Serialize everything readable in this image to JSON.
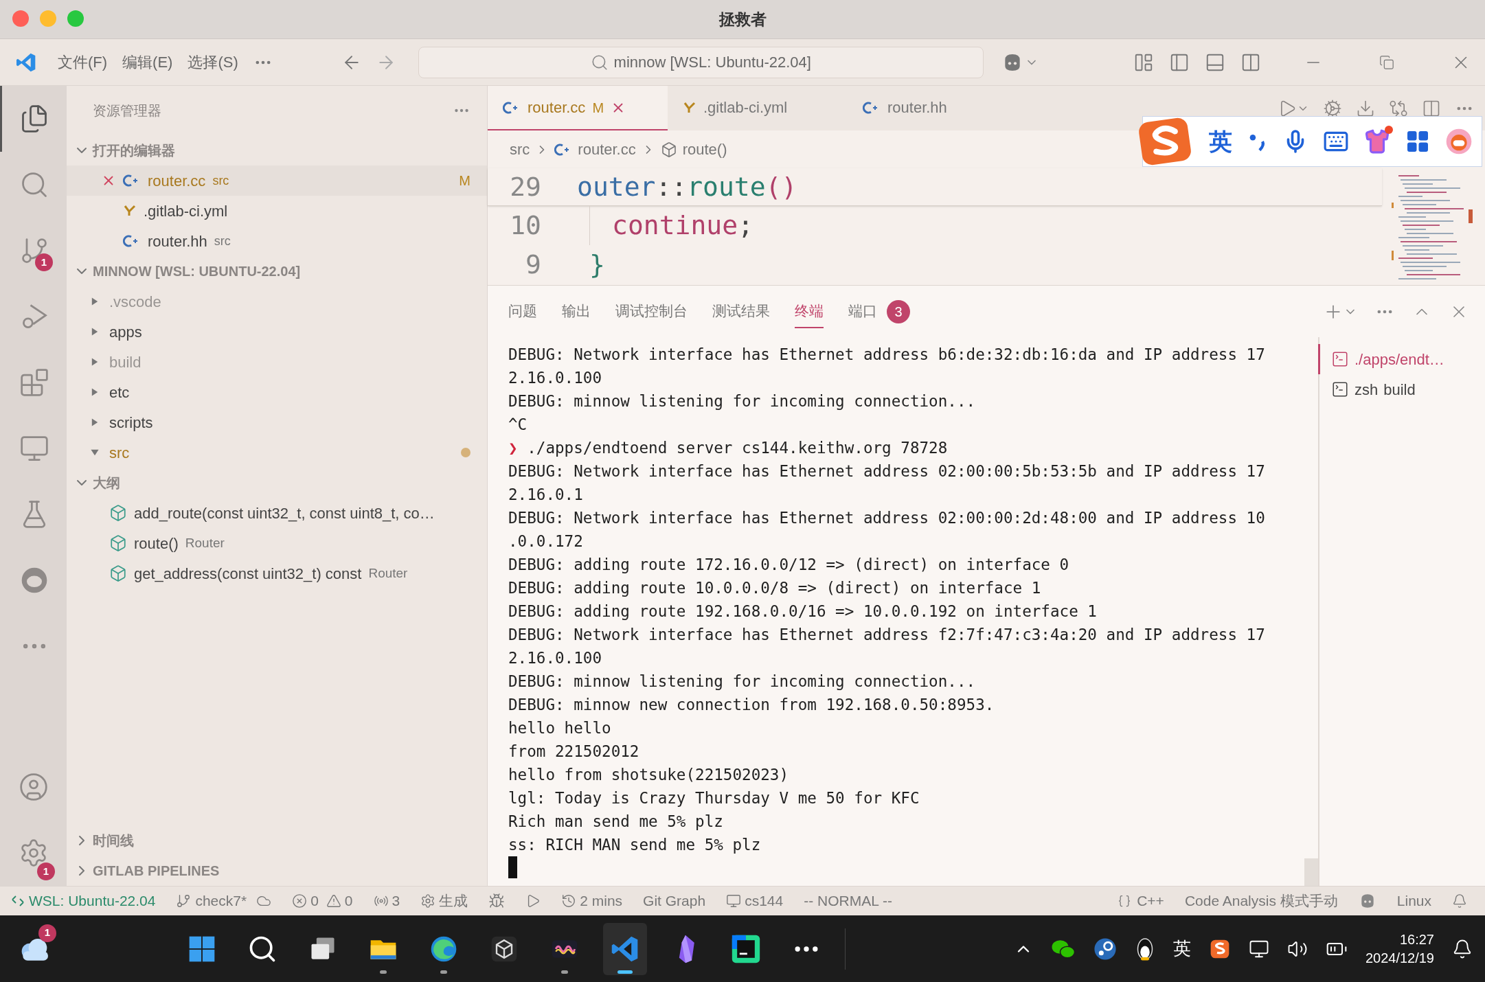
{
  "window": {
    "title": "拯救者"
  },
  "menu": {
    "items": [
      "文件(F)",
      "编辑(E)",
      "选择(S)"
    ]
  },
  "command_center": {
    "text": "minnow [WSL: Ubuntu-22.04]"
  },
  "activity_bar": {
    "items": [
      {
        "kind": "explorer",
        "selected": true
      },
      {
        "kind": "search",
        "selected": false
      },
      {
        "kind": "git",
        "selected": false,
        "badge": "1"
      },
      {
        "kind": "debug",
        "selected": false
      },
      {
        "kind": "extensions",
        "selected": false
      },
      {
        "kind": "remote",
        "selected": false
      },
      {
        "kind": "testing",
        "selected": false
      },
      {
        "kind": "round",
        "selected": false
      },
      {
        "kind": "more",
        "selected": false
      }
    ],
    "bottom": [
      {
        "kind": "account"
      },
      {
        "kind": "settings",
        "badge": "1"
      }
    ]
  },
  "sidebar": {
    "title": "资源管理器",
    "open_editors": {
      "title": "打开的编辑器",
      "expanded": true,
      "items": [
        {
          "kind": "cpp",
          "name": "router.cc",
          "detail": "src",
          "badge": "M",
          "selected": true
        },
        {
          "kind": "yaml",
          "name": ".gitlab-ci.yml",
          "selected": false
        },
        {
          "kind": "cpp",
          "name": "router.hh",
          "detail": "src",
          "selected": false
        }
      ]
    },
    "folder": {
      "title": "MINNOW [WSL: UBUNTU-22.04]",
      "expanded": true,
      "items": [
        {
          "name": ".vscode",
          "expanded": false,
          "ignored": true,
          "modified": false
        },
        {
          "name": "apps",
          "expanded": false,
          "ignored": false,
          "modified": false
        },
        {
          "name": "build",
          "expanded": false,
          "ignored": true,
          "modified": false
        },
        {
          "name": "etc",
          "expanded": false,
          "ignored": false,
          "modified": false
        },
        {
          "name": "scripts",
          "expanded": false,
          "ignored": false,
          "modified": false
        },
        {
          "name": "src",
          "expanded": true,
          "ignored": false,
          "modified": true
        }
      ]
    },
    "outline": {
      "title": "大纲",
      "expanded": true,
      "items": [
        {
          "name": "add_route(const uint32_t, const uint8_t, co…"
        },
        {
          "name": "route()",
          "detail": "Router"
        },
        {
          "name": "get_address(const uint32_t) const",
          "detail": "Router"
        }
      ]
    },
    "timeline": {
      "title": "时间线",
      "expanded": false
    },
    "pipelines": {
      "title": "GITLAB PIPELINES",
      "expanded": false
    }
  },
  "editor": {
    "tabs": [
      {
        "kind": "cpp",
        "name": "router.cc",
        "badge": "M",
        "selected": true
      },
      {
        "kind": "yaml",
        "name": ".gitlab-ci.yml",
        "selected": false
      },
      {
        "kind": "cpp",
        "name": "router.hh",
        "selected": false
      }
    ],
    "breadcrumbs": [
      {
        "kind": "folder",
        "text": "src"
      },
      {
        "kind": "cpp",
        "text": "router.cc"
      },
      {
        "kind": "method",
        "text": "route()"
      }
    ],
    "sticky": {
      "number": "29",
      "tokens": [
        {
          "kind": "type",
          "text": "outer"
        },
        {
          "kind": "punct",
          "text": "::"
        },
        {
          "kind": "func",
          "text": "route"
        },
        {
          "kind": "paren",
          "text": "()"
        }
      ]
    },
    "lines": [
      {
        "number": "10",
        "indented": true,
        "tokens": [
          {
            "kind": "keyword",
            "text": "continue"
          },
          {
            "kind": "punct",
            "text": ";"
          }
        ]
      },
      {
        "number": "9",
        "indented": false,
        "tokens": [
          {
            "kind": "brace",
            "text": "}"
          }
        ]
      }
    ]
  },
  "ime": {
    "lang": "英"
  },
  "panel": {
    "tabs": [
      {
        "label": "问题",
        "selected": false
      },
      {
        "label": "输出",
        "selected": false
      },
      {
        "label": "调试控制台",
        "selected": false
      },
      {
        "label": "测试结果",
        "selected": false
      },
      {
        "label": "终端",
        "selected": true
      },
      {
        "label": "端口",
        "selected": false,
        "badge": "3"
      }
    ],
    "terminal": [
      {
        "kind": "output",
        "text": "DEBUG: Network interface has Ethernet address b6:de:32:db:16:da and IP address 17"
      },
      {
        "kind": "output",
        "text": "2.16.0.100"
      },
      {
        "kind": "output",
        "text": "DEBUG: minnow listening for incoming connection..."
      },
      {
        "kind": "output",
        "text": "^C"
      },
      {
        "kind": "prompt",
        "mark": "❯",
        "text": "./apps/endtoend server cs144.keithw.org 78728"
      },
      {
        "kind": "output",
        "text": "DEBUG: Network interface has Ethernet address 02:00:00:5b:53:5b and IP address 17"
      },
      {
        "kind": "output",
        "text": "2.16.0.1"
      },
      {
        "kind": "output",
        "text": "DEBUG: Network interface has Ethernet address 02:00:00:2d:48:00 and IP address 10"
      },
      {
        "kind": "output",
        "text": ".0.0.172"
      },
      {
        "kind": "output",
        "text": "DEBUG: adding route 172.16.0.0/12 => (direct) on interface 0"
      },
      {
        "kind": "output",
        "text": "DEBUG: adding route 10.0.0.0/8 => (direct) on interface 1"
      },
      {
        "kind": "output",
        "text": "DEBUG: adding route 192.168.0.0/16 => 10.0.0.192 on interface 1"
      },
      {
        "kind": "output",
        "text": "DEBUG: Network interface has Ethernet address f2:7f:47:c3:4a:20 and IP address 17"
      },
      {
        "kind": "output",
        "text": "2.16.0.100"
      },
      {
        "kind": "output",
        "text": "DEBUG: minnow listening for incoming connection..."
      },
      {
        "kind": "output",
        "text": "DEBUG: minnow new connection from 192.168.0.50:8953."
      },
      {
        "kind": "output",
        "text": "hello hello"
      },
      {
        "kind": "output",
        "text": "from 221502012"
      },
      {
        "kind": "output",
        "text": "hello from shotsuke(221502023)"
      },
      {
        "kind": "output",
        "text": "lgl: Today is Crazy Thursday V me 50 for KFC"
      },
      {
        "kind": "output",
        "text": "Rich man send me 5% plz"
      },
      {
        "kind": "output",
        "text": "ss: RICH MAN send me 5% plz"
      }
    ],
    "sessions": [
      {
        "name": "./apps/endt…",
        "selected": true
      },
      {
        "name": "zsh",
        "detail": "build",
        "selected": false
      }
    ]
  },
  "status_bar": {
    "remote": "WSL: Ubuntu-22.04",
    "branch": "check7*",
    "errors": "0",
    "warnings": "0",
    "ports": "3",
    "build": "生成",
    "time_ago": "2 mins",
    "git_graph": "Git Graph",
    "target": "cs144",
    "mode": "-- NORMAL --",
    "language": "C++",
    "analysis": "Code Analysis 模式手动",
    "os": "Linux"
  },
  "taskbar": {
    "weather_badge": "1",
    "apps": [
      {
        "kind": "start",
        "running": false,
        "active": false
      },
      {
        "kind": "search",
        "running": false,
        "active": false
      },
      {
        "kind": "taskview",
        "running": false,
        "active": false
      },
      {
        "kind": "files",
        "running": true,
        "active": false
      },
      {
        "kind": "edge",
        "running": true,
        "active": false
      },
      {
        "kind": "cube",
        "running": false,
        "active": false
      },
      {
        "kind": "wave",
        "running": true,
        "active": false
      },
      {
        "kind": "vscode",
        "running": true,
        "active": true
      },
      {
        "kind": "gem",
        "running": false,
        "active": false
      },
      {
        "kind": "clion",
        "running": false,
        "active": false
      },
      {
        "kind": "more",
        "running": false,
        "active": false
      }
    ],
    "ime": "英",
    "time": "16:27",
    "date": "2024/12/19"
  }
}
